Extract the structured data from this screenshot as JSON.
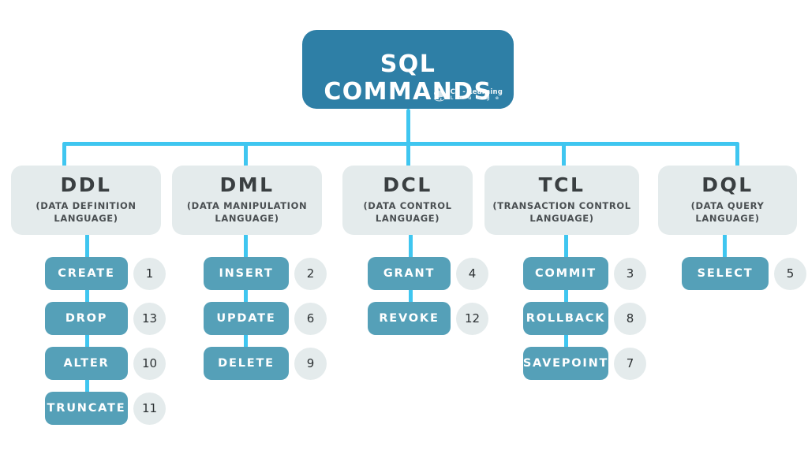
{
  "header": {
    "title": "SQL COMMANDS",
    "brand_name": "Co - Learning",
    "brand_sub": "L o u n g e",
    "brand_icon": "brain-logo-icon"
  },
  "colors": {
    "header_blue": "#2E7FA6",
    "pill_blue": "#55A0B8",
    "connector_cyan": "#3FC6F0",
    "card_gray": "#E4EBEC",
    "text_dark": "#3A3F41",
    "page_background": "#FFFFFF"
  },
  "categories": [
    {
      "abbr": "DDL",
      "full": "(DATA DEFINITION LANGUAGE)",
      "commands": [
        {
          "label": "CREATE",
          "number": "1"
        },
        {
          "label": "DROP",
          "number": "13"
        },
        {
          "label": "ALTER",
          "number": "10"
        },
        {
          "label": "TRUNCATE",
          "number": "11"
        }
      ]
    },
    {
      "abbr": "DML",
      "full": "(DATA MANIPULATION LANGUAGE)",
      "commands": [
        {
          "label": "INSERT",
          "number": "2"
        },
        {
          "label": "UPDATE",
          "number": "6"
        },
        {
          "label": "DELETE",
          "number": "9"
        }
      ]
    },
    {
      "abbr": "DCL",
      "full": "(DATA CONTROL LANGUAGE)",
      "commands": [
        {
          "label": "GRANT",
          "number": "4"
        },
        {
          "label": "REVOKE",
          "number": "12"
        }
      ]
    },
    {
      "abbr": "TCL",
      "full": "(TRANSACTION CONTROL LANGUAGE)",
      "commands": [
        {
          "label": "COMMIT",
          "number": "3"
        },
        {
          "label": "ROLLBACK",
          "number": "8"
        },
        {
          "label": "SAVEPOINT",
          "number": "7"
        }
      ]
    },
    {
      "abbr": "DQL",
      "full": "(DATA QUERY LANGUAGE)",
      "commands": [
        {
          "label": "SELECT",
          "number": "5"
        }
      ]
    }
  ]
}
